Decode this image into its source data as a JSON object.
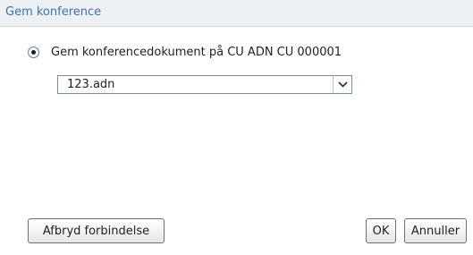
{
  "dialog": {
    "title": "Gem konference"
  },
  "option": {
    "label": "Gem konferencedokument på CU ADN CU 000001",
    "selected": true
  },
  "file_select": {
    "value": "123.adn"
  },
  "buttons": {
    "disconnect_label": "Afbryd forbindelse",
    "ok_label": "OK",
    "cancel_label": "Annuller"
  },
  "icons": {
    "dropdown": "chevron-down-icon",
    "radio": "radio-selected-icon"
  },
  "colors": {
    "title": "#3f73ae",
    "titlebar_bg": "#eef1f4",
    "text": "#222222"
  }
}
